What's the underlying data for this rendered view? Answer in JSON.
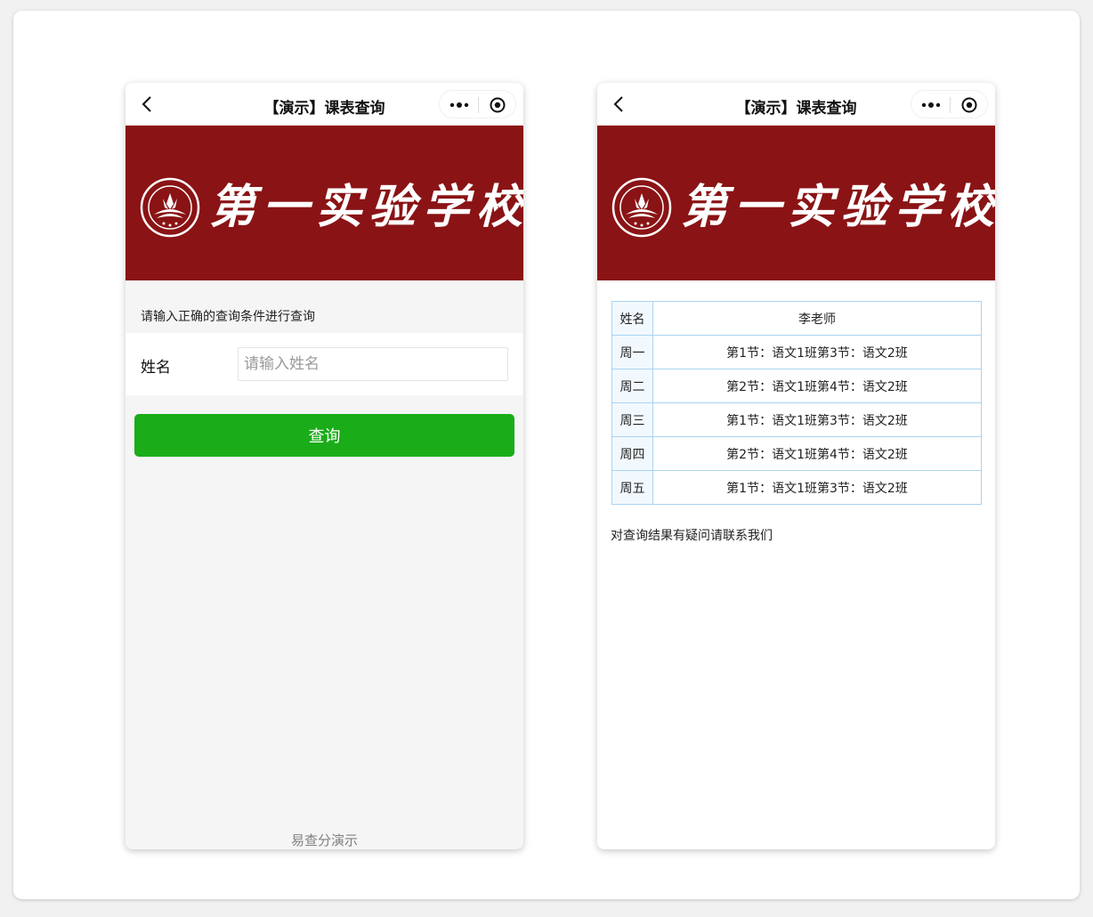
{
  "left_screen": {
    "nav_title": "【演示】课表查询",
    "school_name": "第一实验学校",
    "hint": "请输入正确的查询条件进行查询",
    "name_label": "姓名",
    "name_placeholder": "请输入姓名",
    "name_value": "",
    "query_button": "查询",
    "footer": "易查分演示"
  },
  "right_screen": {
    "nav_title": "【演示】课表查询",
    "school_name": "第一实验学校",
    "rows": [
      {
        "key": "姓名",
        "value": "李老师"
      },
      {
        "key": "周一",
        "value": "第1节：语文1班第3节：语文2班"
      },
      {
        "key": "周二",
        "value": "第2节：语文1班第4节：语文2班"
      },
      {
        "key": "周三",
        "value": "第1节：语文1班第3节：语文2班"
      },
      {
        "key": "周四",
        "value": "第2节：语文1班第4节：语文2班"
      },
      {
        "key": "周五",
        "value": "第1节：语文1班第3节：语文2班"
      }
    ],
    "note": "对查询结果有疑问请联系我们"
  },
  "icons": {
    "back": "back-arrow-icon",
    "more": "more-dots-icon",
    "close": "target-circle-icon",
    "emblem": "school-emblem-icon"
  },
  "colors": {
    "banner": "#8a1315",
    "button": "#1aad19",
    "table_border": "#a9d3f2",
    "key_cell_bg": "#f2f9fe"
  }
}
